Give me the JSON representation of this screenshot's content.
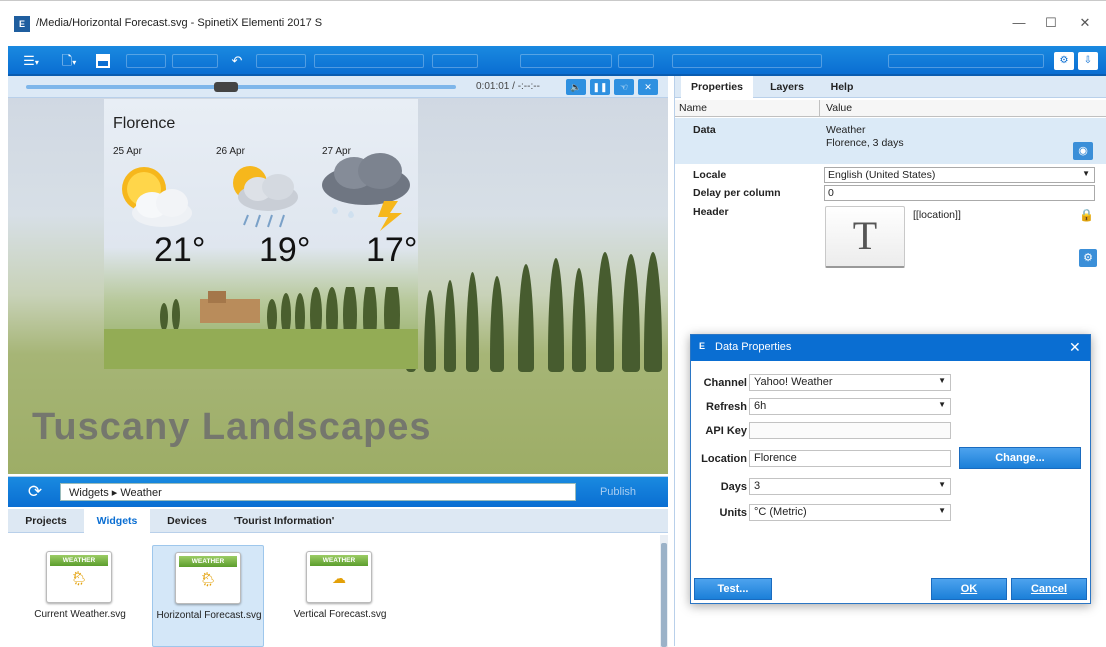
{
  "window": {
    "title": "/Media/Horizontal Forecast.svg - SpinetiX Elementi 2017 S",
    "app_icon": "E",
    "controls": {
      "minimize": "—",
      "maximize": "☐",
      "close": "✕"
    }
  },
  "toolbar": {
    "menu_icon": "☰",
    "new_icon": "🗋",
    "save_icon": "💾",
    "undo_icon": "↶",
    "right_icons": [
      "doc-settings-icon",
      "doc-export-icon"
    ]
  },
  "player": {
    "time": "0:01:01 / -:--:--",
    "progress": 0.49,
    "buttons": [
      "🔈",
      "❚❚",
      "☜",
      "✕"
    ]
  },
  "preview": {
    "overlay_title": "Tuscany Landscapes",
    "weather": {
      "city": "Florence",
      "days": [
        {
          "date": "25 Apr",
          "temp": "21°",
          "icon": "sun-cloud-icon"
        },
        {
          "date": "26 Apr",
          "temp": "19°",
          "icon": "rain-sun-icon"
        },
        {
          "date": "27 Apr",
          "temp": "17°",
          "icon": "thunderstorm-icon"
        }
      ]
    }
  },
  "widgets_bar": {
    "breadcrumb": "Widgets ▸ Weather",
    "publish": "Publish"
  },
  "widget_tabs": [
    "Projects",
    "Widgets",
    "Devices",
    "'Tourist Information'"
  ],
  "widget_tabs_active": 1,
  "widgets": [
    {
      "header": "WEATHER",
      "label": "Current Weather.svg",
      "glyph": "🌦"
    },
    {
      "header": "WEATHER",
      "label": "Horizontal Forecast.svg",
      "glyph": "🌦"
    },
    {
      "header": "WEATHER",
      "label": "Vertical Forecast.svg",
      "glyph": "☁"
    }
  ],
  "props": {
    "tabs": [
      "Properties",
      "Layers",
      "Help"
    ],
    "columns": {
      "name": "Name",
      "value": "Value"
    },
    "rows": {
      "data": {
        "name": "Data",
        "value_line1": "Weather",
        "value_line2": "Florence, 3 days"
      },
      "locale": {
        "name": "Locale",
        "value": "English (United States)"
      },
      "delay": {
        "name": "Delay per column",
        "value": "0"
      },
      "header": {
        "name": "Header",
        "value": "[[location]]",
        "text_button": "T"
      }
    }
  },
  "dialog": {
    "title": "Data Properties",
    "fields": {
      "channel": {
        "label": "Channel",
        "value": "Yahoo! Weather"
      },
      "refresh": {
        "label": "Refresh",
        "value": "6h"
      },
      "api_key": {
        "label": "API Key",
        "value": ""
      },
      "location": {
        "label": "Location",
        "value": "Florence"
      },
      "days": {
        "label": "Days",
        "value": "3"
      },
      "units": {
        "label": "Units",
        "value": "°C (Metric)"
      }
    },
    "buttons": {
      "change": "Change...",
      "test": "Test...",
      "ok": "OK",
      "cancel": "Cancel"
    }
  }
}
